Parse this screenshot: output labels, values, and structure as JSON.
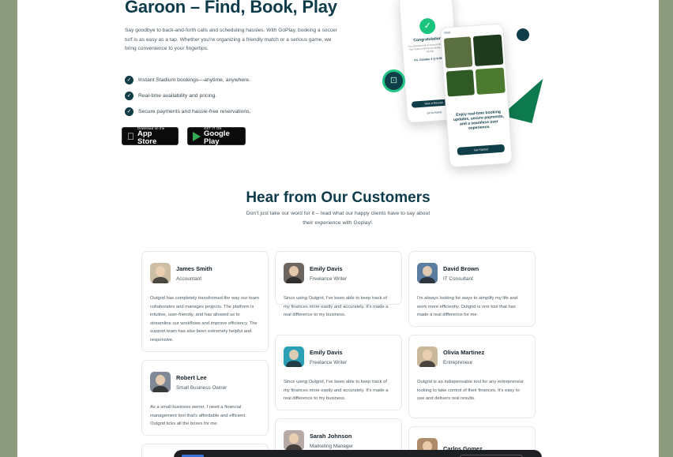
{
  "hero": {
    "title": "Garoon – Find, Book, Play",
    "description": "Say goodbye to back-and-forth calls and scheduling hassles. With GoPlay, booking a soccer turf is as easy as a tap. Whether you're organizing a friendly match or a serious game, we bring convenience to your fingertips.",
    "features": [
      "Instant Stadium bookings—anytime, anywhere.",
      "Real-time availability and pricing.",
      "Secure payments and hassle-free reservations."
    ],
    "app_store": {
      "small": "Download on the",
      "big": "App Store"
    },
    "google_play": {
      "small": "GET IT ON",
      "big": "Google Play"
    }
  },
  "mockup": {
    "phone1_title": "Congratulations!",
    "phone1_sub": "You (Stadium link & Soccer) Ali Bookings Your ticket confirmed booking on the go Facility",
    "phone1_date": "Fri, October 4 @ 6:00 PM",
    "phone1_btn": "View e-Receipt",
    "phone1_link": "Go to Home",
    "phone2_header": "Goal",
    "phone2_title": "Enjoy real-time booking updates, secure payments, and a seamless user experience.",
    "phone2_btn": "Get Started"
  },
  "testimonials": {
    "title": "Hear from Our Customers",
    "subtitle": "Don't just take our word for it – read what our happy clients have to say about their experience with Goplay!.",
    "cards": [
      {
        "name": "James Smith",
        "role": "Accountant",
        "quote": "Outgrid has completely transformed the way our team collaborates and manages projects. The platform is intuitive, user-friendly, and has allowed us to streamline our workflows and improve efficiency. The support team has also been extremely helpful and responsive."
      },
      {
        "name": "Emily Davis",
        "role": "Freelance Writer",
        "quote": "Since using Outgrid, I've been able to keep track of my finances more easily and accurately. It's made a real difference to my business."
      },
      {
        "name": "David Brown",
        "role": "IT Consultant",
        "quote": "I'm always looking for ways to simplify my life and work more efficiently. Outgrid is one tool that has made a real difference for me."
      },
      {
        "name": "Robert Lee",
        "role": "Small Business Owner",
        "quote": "As a small business owner, I need a financial management tool that's affordable and efficient. Outgrid ticks all the boxes for me."
      },
      {
        "name": "Emily Davis",
        "role": "Freelance Writer",
        "quote": "Since using Outgrid, I've been able to keep track of my finances more easily and accurately. It's made a real difference to my business."
      },
      {
        "name": "Olivia Martinez",
        "role": "Entrepreneur",
        "quote": "Outgrid is an indispensable tool for any entrepreneur looking to take control of their finances. It's easy to use and delivers real results."
      },
      {
        "name": "Sarah Johnson",
        "role": "Marketing Manager",
        "quote": ""
      },
      {
        "name": "Carlos Gomez",
        "role": "",
        "quote": ""
      }
    ]
  },
  "colors": {
    "brand": "#0d3b4a",
    "accent": "#1bc47d",
    "backdrop": "#8c9a7d"
  }
}
